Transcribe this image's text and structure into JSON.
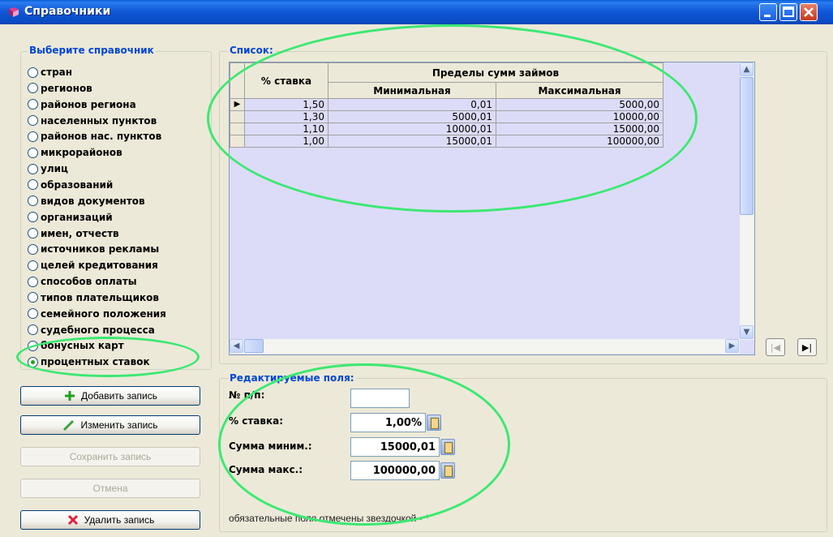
{
  "window": {
    "title": "Справочники"
  },
  "left_panel": {
    "title": "Выберите справочник",
    "items": [
      {
        "label": "стран",
        "checked": false
      },
      {
        "label": "регионов",
        "checked": false
      },
      {
        "label": "районов региона",
        "checked": false
      },
      {
        "label": "населенных пунктов",
        "checked": false
      },
      {
        "label": "районов нас. пунктов",
        "checked": false
      },
      {
        "label": "микрорайонов",
        "checked": false
      },
      {
        "label": "улиц",
        "checked": false
      },
      {
        "label": "образований",
        "checked": false
      },
      {
        "label": "видов документов",
        "checked": false
      },
      {
        "label": "организаций",
        "checked": false
      },
      {
        "label": "имен, отчеств",
        "checked": false
      },
      {
        "label": "источников рекламы",
        "checked": false
      },
      {
        "label": "целей кредитования",
        "checked": false
      },
      {
        "label": "способов оплаты",
        "checked": false
      },
      {
        "label": "типов плательщиков",
        "checked": false
      },
      {
        "label": "семейного положения",
        "checked": false
      },
      {
        "label": "судебного процесса",
        "checked": false
      },
      {
        "label": "бонусных карт",
        "checked": false
      },
      {
        "label": "процентных ставок",
        "checked": true
      }
    ]
  },
  "buttons": {
    "add": "Добавить запись",
    "edit": "Изменить запись",
    "save": "Сохранить запись",
    "cancel": "Отмена",
    "delete": "Удалить запись"
  },
  "list": {
    "title": "Список:",
    "headers": {
      "rate": "% ставка",
      "group": "Пределы сумм займов",
      "min": "Минимальная",
      "max": "Максимальная"
    },
    "rows": [
      {
        "rate": "1,50",
        "min": "0,01",
        "max": "5000,00"
      },
      {
        "rate": "1,30",
        "min": "5000,01",
        "max": "10000,00"
      },
      {
        "rate": "1,10",
        "min": "10000,01",
        "max": "15000,00"
      },
      {
        "rate": "1,00",
        "min": "15000,01",
        "max": "100000,00"
      }
    ]
  },
  "edit_fields": {
    "title": "Редактируемые поля:",
    "number_label": "№ п/п:",
    "number_value": "",
    "rate_label": "% ставка:",
    "rate_value": "1,00%",
    "min_label": "Сумма миним.:",
    "min_value": "15000,01",
    "max_label": "Сумма макс.:",
    "max_value": "100000,00"
  },
  "footer_note": "обязательные поля отмечены звездочкой - *",
  "colors": {
    "titlebar": "#0A4CC4",
    "group_title": "#0046D5",
    "grid_bg": "#DCDCF8",
    "highlight": "#3CE872"
  }
}
